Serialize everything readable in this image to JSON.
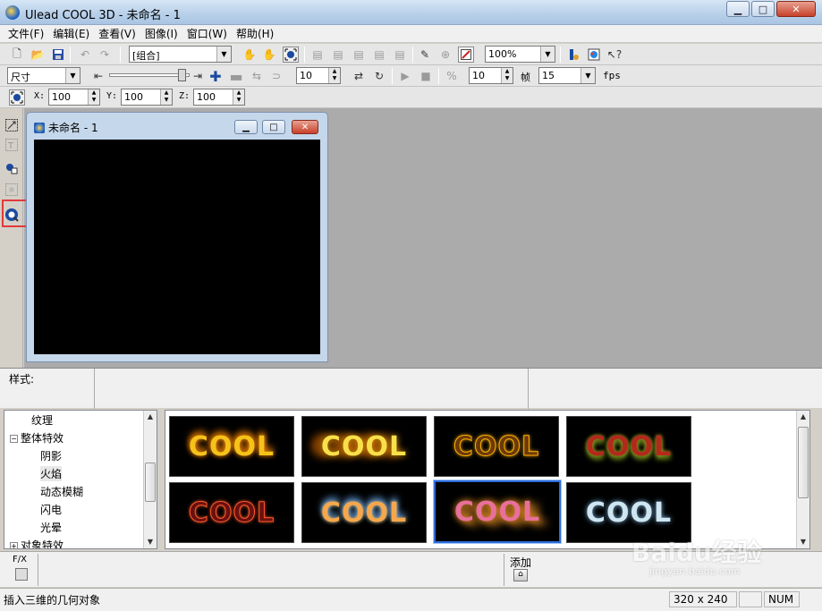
{
  "window": {
    "title": "Ulead COOL 3D - 未命名 - 1",
    "min": "▁",
    "max": "□",
    "close": "✕"
  },
  "menu": [
    "文件(F)",
    "编辑(E)",
    "查看(V)",
    "图像(I)",
    "窗口(W)",
    "帮助(H)"
  ],
  "toolbar1": {
    "object_combo": "[组合]",
    "zoom_combo": "100%"
  },
  "toolbar2": {
    "size_combo": "尺寸",
    "step_value": "10",
    "frame_value": "10",
    "frame_label": "帧",
    "fps_value": "15",
    "fps_label": "fps"
  },
  "toolbar3": {
    "x_label": "X:",
    "x_value": "100",
    "y_label": "Y:",
    "y_value": "100",
    "z_label": "Z:",
    "z_value": "100"
  },
  "document": {
    "title": "未命名 - 1"
  },
  "styles": {
    "label": "样式:"
  },
  "tree": {
    "items": [
      {
        "label": "纹理",
        "level": 2
      },
      {
        "label": "整体特效",
        "level": 1,
        "expander": "−"
      },
      {
        "label": "阴影",
        "level": 2
      },
      {
        "label": "火焰",
        "level": 2,
        "selected": true
      },
      {
        "label": "动态模糊",
        "level": 2
      },
      {
        "label": "闪电",
        "level": 2
      },
      {
        "label": "光晕",
        "level": 2
      },
      {
        "label": "对象特效",
        "level": 1,
        "expander": "+"
      }
    ]
  },
  "gallery": {
    "thumb_text": "COOL",
    "thumbs": [
      {
        "fill": "#f5c21a",
        "glow": "#ff8a00"
      },
      {
        "fill": "#f7e04a",
        "glow": "#ffa600"
      },
      {
        "fill": "#6b3a0a",
        "glow": "#ffb000"
      },
      {
        "fill": "#b3291c",
        "glow": "#7fa11e"
      },
      {
        "fill": "#6a1010",
        "glow": "#ff5a2a"
      },
      {
        "fill": "#f6a74b",
        "glow": "#6fb4ff"
      },
      {
        "fill": "#e8709a",
        "glow": "#ff9d2a",
        "selected": true
      },
      {
        "fill": "#cfe6f0",
        "glow": "#7bb4e0"
      }
    ]
  },
  "fx": {
    "label": "F/X",
    "add_label": "添加"
  },
  "status": {
    "message": "插入三维的几何对象",
    "size": "320 x 240",
    "num": "NUM"
  },
  "watermark": {
    "brand": "Baidu经验",
    "url": "jingyan.baidu.com"
  },
  "colors": {
    "highlight": "#e23a3a",
    "canvas": "#000000",
    "workspace": "#ababab"
  }
}
